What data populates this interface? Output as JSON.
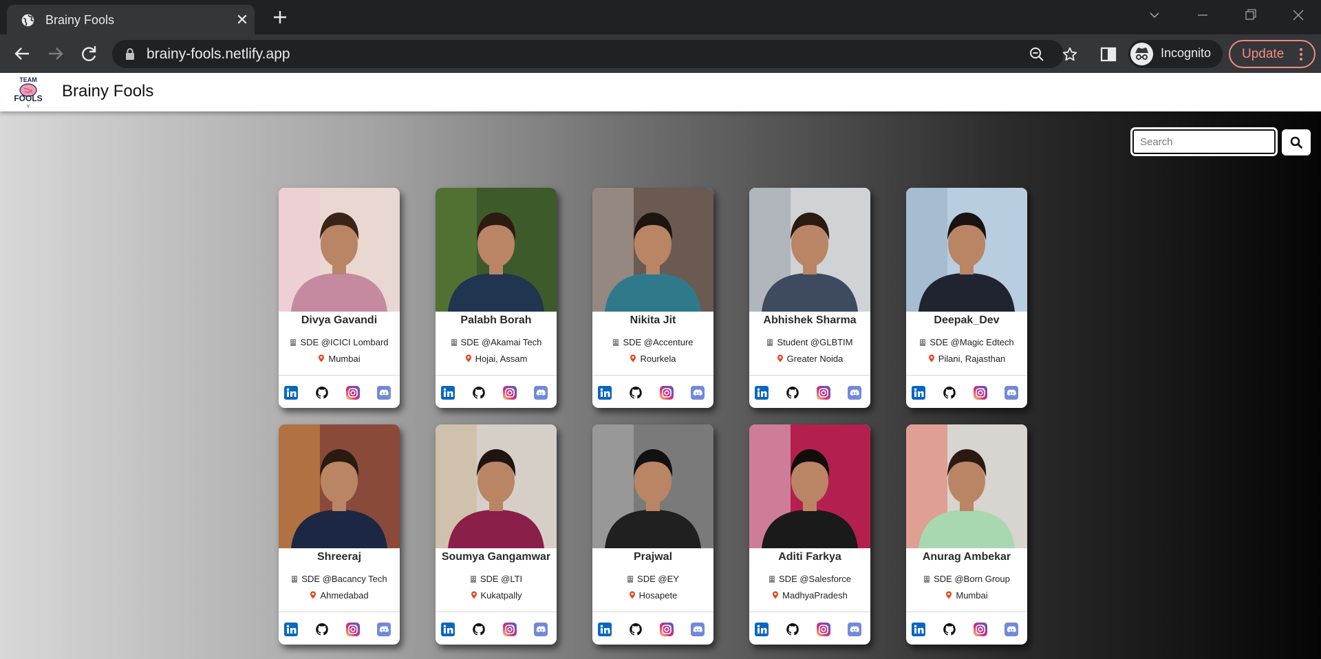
{
  "browser": {
    "tab_title": "Brainy Fools",
    "url": "brainy-fools.netlify.app",
    "profile_label": "Incognito",
    "update_label": "Update"
  },
  "site": {
    "brand": "Brainy Fools",
    "logo_text": [
      "TEAM",
      "FOOLS",
      "Y"
    ],
    "search_placeholder": "Search"
  },
  "members": [
    {
      "name": "Divya Gavandi",
      "job": "SDE @ICICI Lombard",
      "location": "Mumbai"
    },
    {
      "name": "Palabh Borah",
      "job": "SDE @Akamai Tech",
      "location": "Hojai, Assam"
    },
    {
      "name": "Nikita Jit",
      "job": "SDE @Accenture",
      "location": "Rourkela"
    },
    {
      "name": "Abhishek Sharma",
      "job": "Student @GLBTIM",
      "location": "Greater Noida"
    },
    {
      "name": "Deepak_Dev",
      "job": "SDE @Magic Edtech",
      "location": "Pilani, Rajasthan"
    },
    {
      "name": "Shreeraj",
      "job": "SDE @Bacancy Tech",
      "location": "Ahmedabad"
    },
    {
      "name": "Soumya Gangamwar",
      "job": "SDE @LTI",
      "location": "Kukatpally"
    },
    {
      "name": "Prajwal",
      "job": "SDE @EY",
      "location": "Hosapete"
    },
    {
      "name": "Aditi Farkya",
      "job": "SDE @Salesforce",
      "location": "MadhyaPradesh"
    },
    {
      "name": "Anurag Ambekar",
      "job": "SDE @Born Group",
      "location": "Mumbai"
    }
  ],
  "social_icons": [
    "linkedin-icon",
    "github-icon",
    "instagram-icon",
    "discord-icon"
  ],
  "colors": {
    "linkedin": "#0a66c2",
    "instagram": "#e1306c",
    "discord": "#7289da",
    "location_pin": "#e8471c",
    "update_accent": "#f28b82"
  }
}
